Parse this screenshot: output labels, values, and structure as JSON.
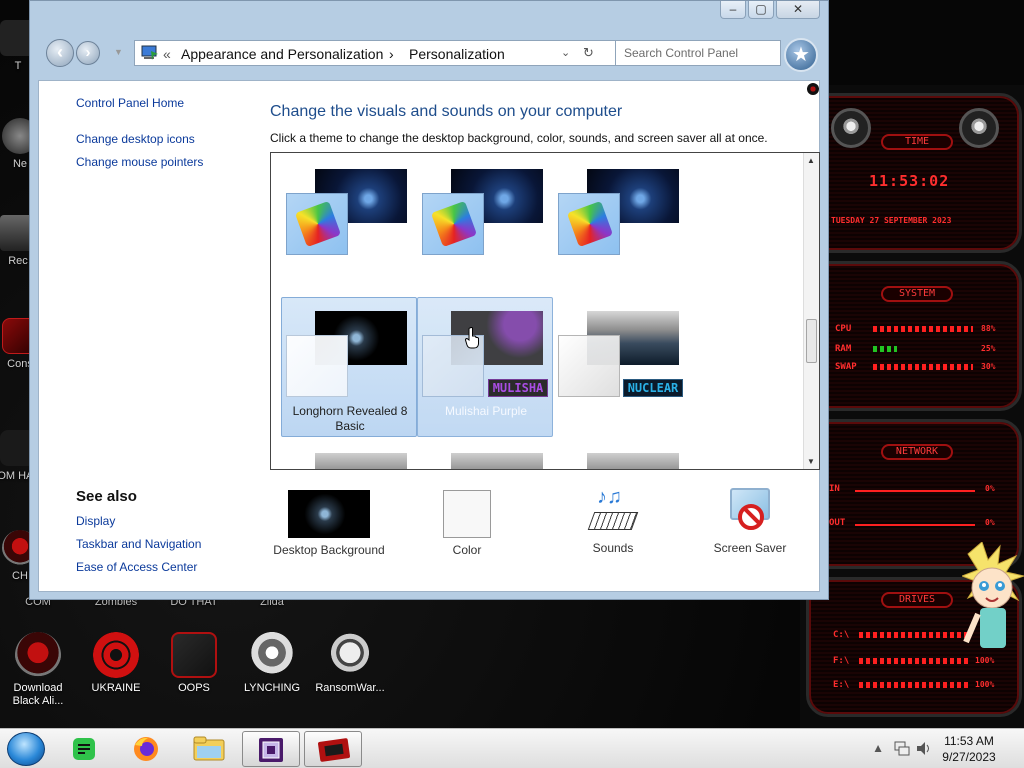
{
  "desktop": {
    "icons_partial_left": [
      {
        "label": "T"
      },
      {
        "label": "Ne"
      },
      {
        "label": "Rec"
      },
      {
        "label": "Cons"
      },
      {
        "label": "COM HATE"
      },
      {
        "label": "CH"
      }
    ],
    "behind_window_labels": [
      "COM",
      "Zombies",
      "DO THAT",
      "Zilda"
    ],
    "icons": [
      {
        "label": "Download Black Ali...",
        "icon": "alien-icon"
      },
      {
        "label": "UKRAINE",
        "icon": "radiation-icon"
      },
      {
        "label": "OOPS",
        "icon": "oops-icon"
      },
      {
        "label": "LYNCHING",
        "icon": "lynching-icon"
      },
      {
        "label": "RansomWar...",
        "icon": "skull-icon"
      }
    ],
    "gadgets": {
      "time": {
        "title": "TIME",
        "clock": "11:53:02",
        "date": "TUESDAY 27 SEPTEMBER 2023"
      },
      "system": {
        "title": "SYSTEM",
        "rows": [
          {
            "label": "CPU",
            "value": "88%"
          },
          {
            "label": "RAM",
            "value": "25%"
          },
          {
            "label": "SWAP",
            "value": "30%"
          }
        ]
      },
      "network": {
        "title": "NETWORK",
        "rows": [
          {
            "label": "IN",
            "value": "0%"
          },
          {
            "label": "OUT",
            "value": "0%"
          }
        ]
      },
      "drives": {
        "title": "DRIVES",
        "rows": [
          {
            "label": "C:\\",
            "value": ""
          },
          {
            "label": "F:\\",
            "value": "100%"
          },
          {
            "label": "E:\\",
            "value": "100%"
          }
        ]
      }
    }
  },
  "window": {
    "breadcrumb": [
      "Appearance and Personalization",
      "Personalization"
    ],
    "breadcrumb_prefix": "«",
    "search_placeholder": "Search Control Panel",
    "left_links": [
      "Control Panel Home",
      "Change desktop icons",
      "Change mouse pointers"
    ],
    "see_also_title": "See also",
    "see_also_links": [
      "Display",
      "Taskbar and Navigation",
      "Ease of Access Center"
    ],
    "heading": "Change the visuals and sounds on your computer",
    "subheading": "Click a theme to change the desktop background, color, sounds, and screen saver all at once.",
    "themes": [
      {
        "label": "",
        "bg": "blue",
        "swatch": "rainbow"
      },
      {
        "label": "",
        "bg": "blue",
        "swatch": "rainbow"
      },
      {
        "label": "",
        "bg": "blue",
        "swatch": "rainbow"
      },
      {
        "label": "Longhorn Revealed 8 Basic",
        "bg": "dark",
        "swatch": "clear"
      },
      {
        "label": "Mulishai Purple",
        "bg": "mulisha",
        "swatch": "clear",
        "logo": "MULISHA"
      },
      {
        "label": "",
        "bg": "nuclear",
        "swatch": "gray",
        "logo": "NUCLEAR"
      }
    ],
    "bottom": [
      {
        "label": "Desktop Background"
      },
      {
        "label": "Color"
      },
      {
        "label": "Sounds"
      },
      {
        "label": "Screen Saver"
      }
    ]
  },
  "taskbar": {
    "time": "11:53 AM",
    "date": "9/27/2023",
    "buttons": [
      "start-orb",
      "notes-app",
      "firefox",
      "file-explorer",
      "control-panel",
      "alien-app"
    ]
  },
  "colors": {
    "accent": "#1e4d8c",
    "link": "#0b3a9b",
    "gadget_red": "#ff2e2e"
  }
}
